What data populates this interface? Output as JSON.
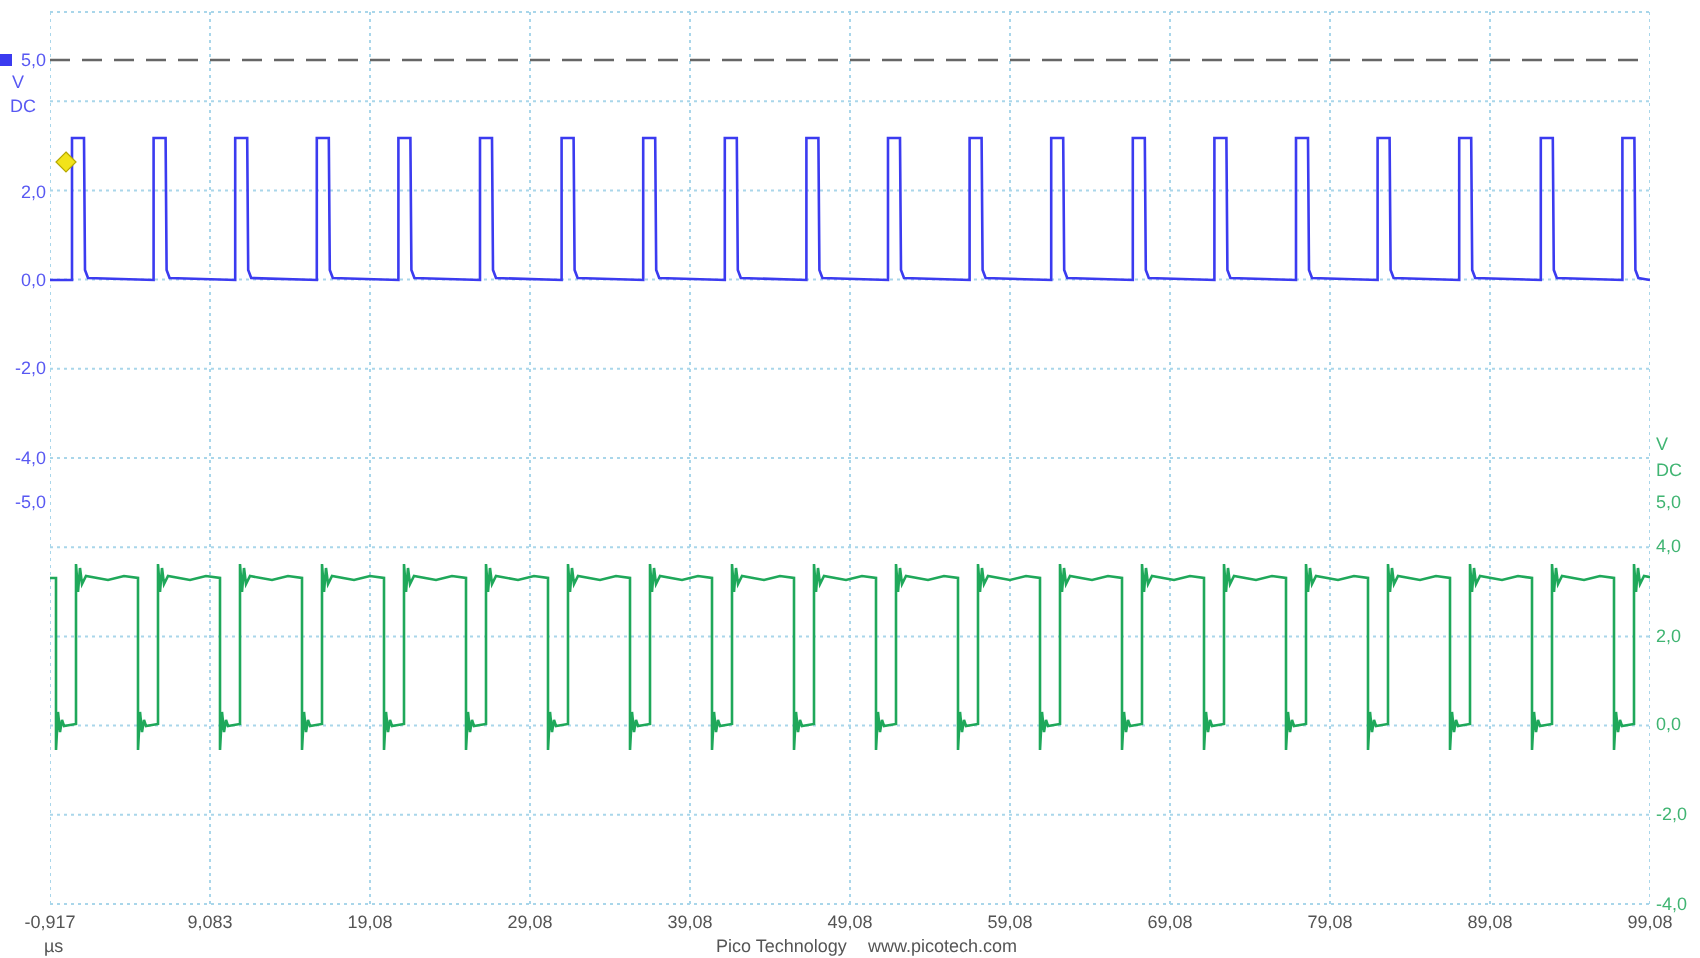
{
  "channels": [
    {
      "color": "#3b3bf0",
      "unit": "V",
      "coupling": "DC",
      "ticks": [
        "5,0",
        "2,0",
        "0,0",
        "-2,0",
        "-4,0",
        "-5,0"
      ]
    },
    {
      "color": "#1fa85a",
      "unit": "V",
      "coupling": "DC",
      "ticks": [
        "5,0",
        "4,0",
        "2,0",
        "0,0",
        "-2,0",
        "-4,0"
      ]
    }
  ],
  "time_axis": {
    "ticks": [
      "-0,917",
      "9,083",
      "19,08",
      "29,08",
      "39,08",
      "49,08",
      "59,08",
      "69,08",
      "79,08",
      "89,08",
      "99,08"
    ],
    "unit": "µs"
  },
  "footer": {
    "brand": "Pico Technology",
    "url": "www.picotech.com"
  }
}
